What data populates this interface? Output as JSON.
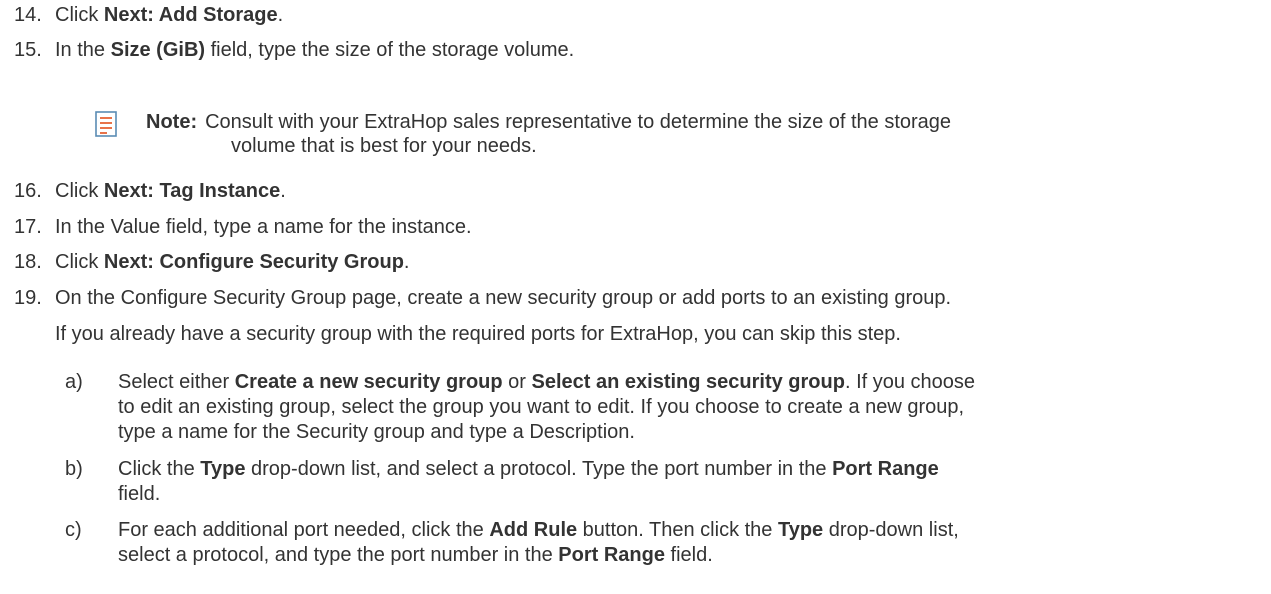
{
  "steps": [
    {
      "num": "14.",
      "pre": "Click ",
      "bold": "Next: Add Storage",
      "post": "."
    },
    {
      "num": "15.",
      "pre": "In the ",
      "bold": "Size (GiB)",
      "post": " field, type the size of the storage volume."
    },
    {
      "num": "16.",
      "pre": "Click ",
      "bold": "Next: Tag Instance",
      "post": "."
    },
    {
      "num": "17.",
      "text": "In the Value field, type a name for the instance."
    },
    {
      "num": "18.",
      "pre": "Click ",
      "bold": "Next: Configure Security Group",
      "post": "."
    },
    {
      "num": "19.",
      "text": "On the Configure Security Group page, create a new security group or add ports to an existing group.",
      "cont": "If you already have a security group with the required ports for ExtraHop, you can skip this step."
    }
  ],
  "note": {
    "icon": "note-icon",
    "label": "Note:",
    "line1": "Consult with your ExtraHop sales representative to determine the size of the storage",
    "line2": "volume that is best for your needs."
  },
  "substeps": {
    "a": {
      "letter": "a)",
      "t1": "Select either ",
      "b1": "Create a new security group",
      "t2": " or ",
      "b2": "Select an existing security group",
      "t3": ". If you choose",
      "line2": "to edit an existing group, select the group you want to edit. If you choose to create a new group,",
      "line3": "type a name for the Security group and type a Description."
    },
    "b": {
      "letter": "b)",
      "t1": "Click the ",
      "b1": "Type",
      "t2": " drop-down list, and select a protocol. Type the port number in the ",
      "b2": "Port Range",
      "line2": "field."
    },
    "c": {
      "letter": "c)",
      "t1": "For each additional port needed, click the ",
      "b1": "Add Rule",
      "t2": " button. Then click the ",
      "b2": "Type",
      "t3": " drop-down list,",
      "l2a": "select a protocol, and type the port number in the ",
      "l2b": "Port Range",
      "l2c": " field."
    }
  },
  "colors": {
    "text": "#333333",
    "note_icon": "#e8734a"
  }
}
